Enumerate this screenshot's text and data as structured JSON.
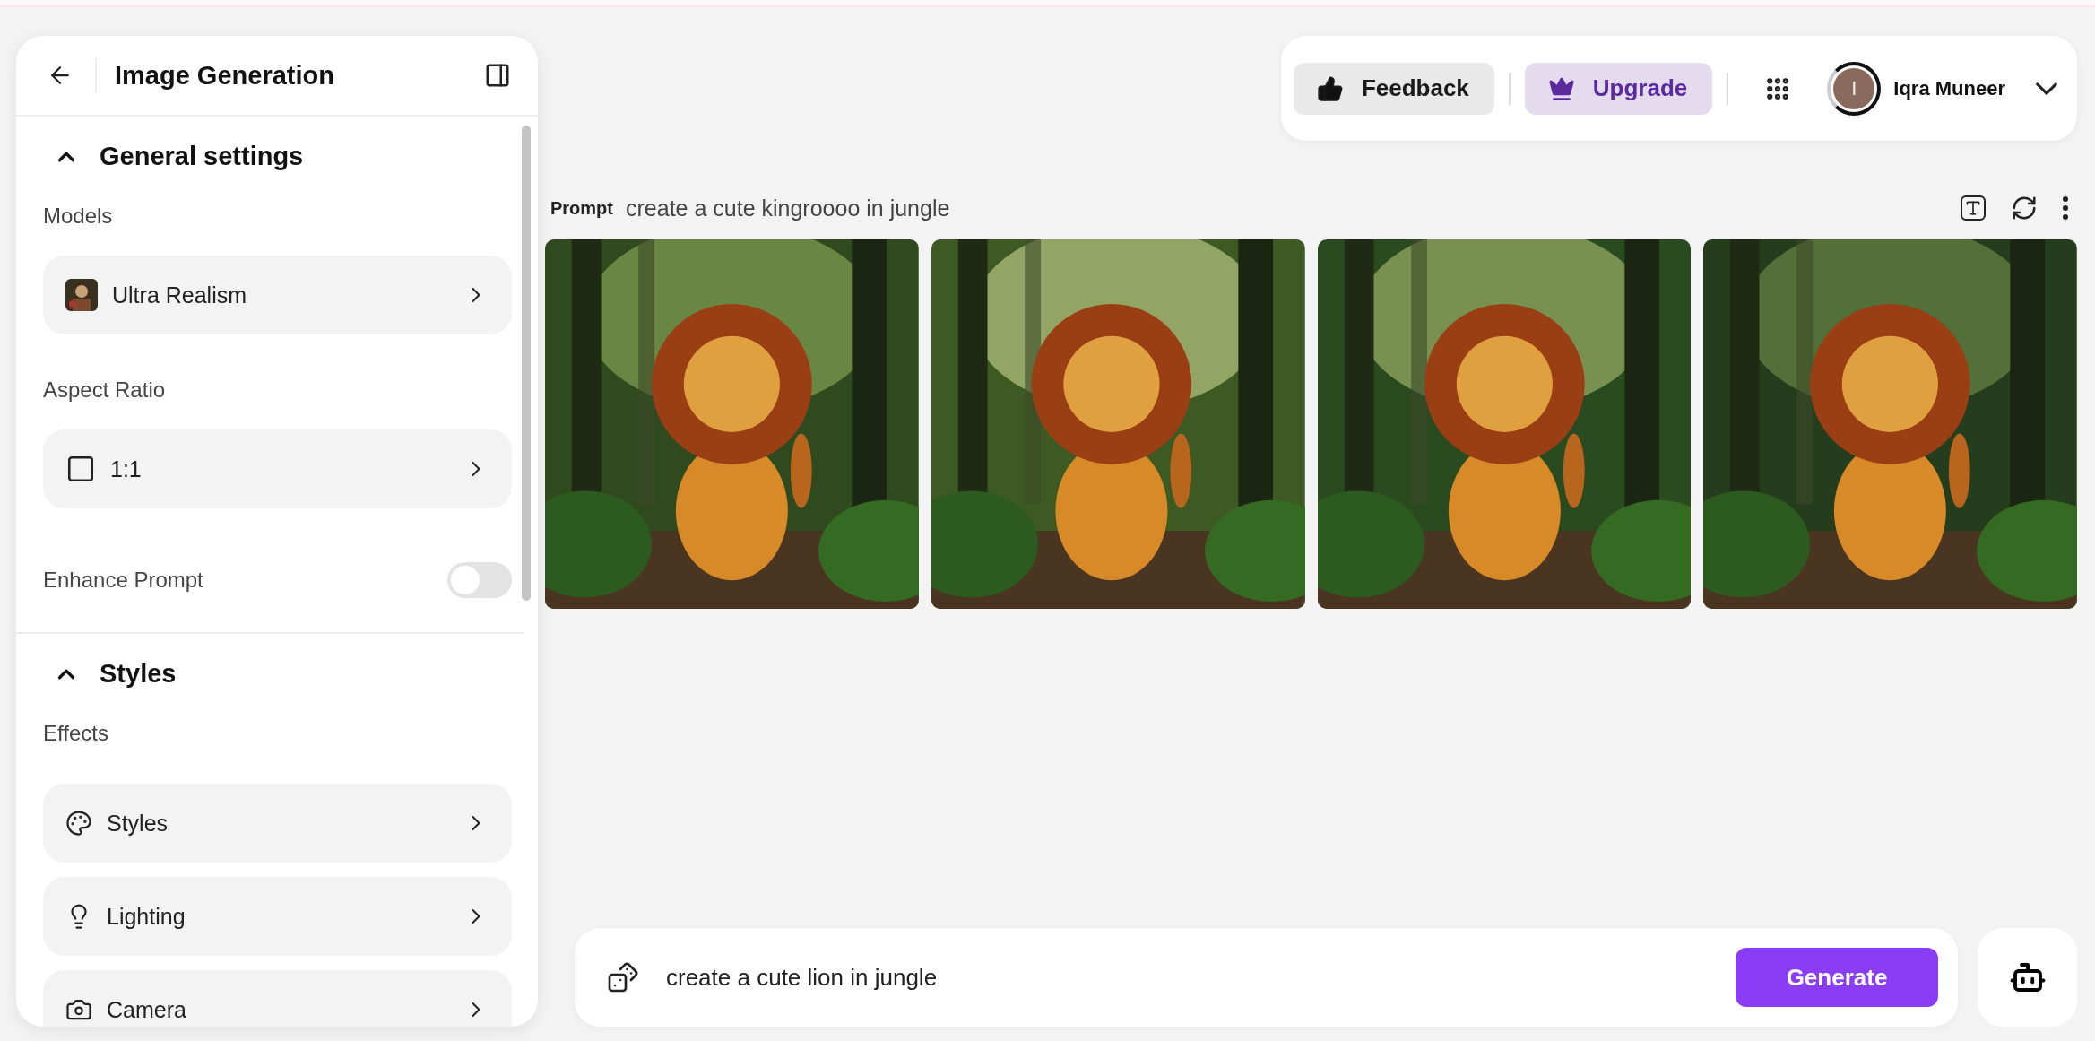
{
  "sidebar": {
    "title": "Image Generation",
    "sections": [
      {
        "title": "General settings",
        "expanded": true,
        "fields": [
          {
            "kind": "select",
            "label": "Models",
            "value": "Ultra Realism"
          },
          {
            "kind": "select",
            "label": "Aspect Ratio",
            "value": "1:1"
          },
          {
            "kind": "toggle",
            "label": "Enhance Prompt",
            "on": false
          }
        ]
      },
      {
        "title": "Styles",
        "expanded": true,
        "fields": [
          {
            "kind": "group",
            "label": "Effects",
            "options": [
              {
                "label": "Styles"
              },
              {
                "label": "Lighting"
              },
              {
                "label": "Camera"
              }
            ]
          }
        ]
      }
    ]
  },
  "header": {
    "feedback": "Feedback",
    "upgrade": "Upgrade",
    "user": {
      "initial": "I",
      "name": "Iqra Muneer"
    }
  },
  "prompt": {
    "label": "Prompt",
    "text": "create a cute kingroooo in jungle"
  },
  "composer": {
    "value": "create a cute lion in jungle",
    "button": "Generate"
  }
}
